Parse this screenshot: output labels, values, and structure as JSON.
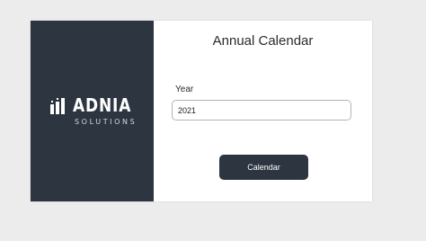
{
  "brand": {
    "name": "ADNIA",
    "tagline": "SOLUTIONS",
    "logo_icon": "bars-logo-icon",
    "panel_color": "#2c3540"
  },
  "form": {
    "title": "Annual Calendar",
    "year_label": "Year",
    "year_value": "2021",
    "submit_label": "Calendar"
  },
  "colors": {
    "accent": "#2c3540",
    "background": "#ececec"
  }
}
